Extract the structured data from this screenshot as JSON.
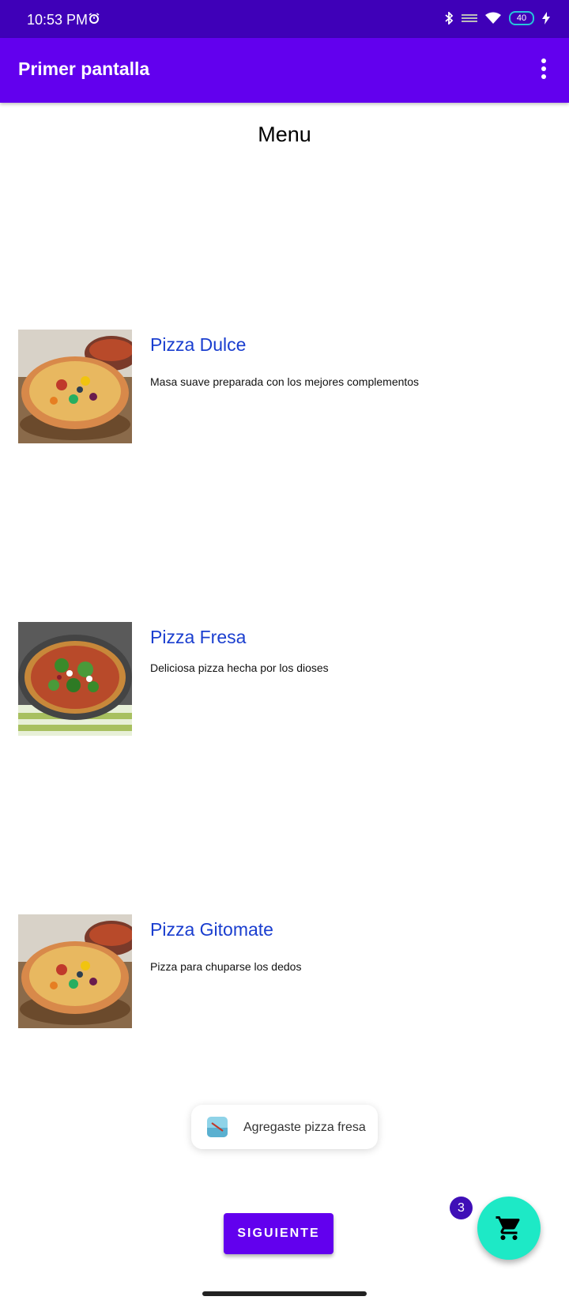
{
  "status_bar": {
    "time": "10:53 PM",
    "battery": "40",
    "icons": [
      "alarm-icon",
      "bluetooth-icon",
      "signal-icon",
      "wifi-icon",
      "battery-icon",
      "charging-icon"
    ]
  },
  "app_bar": {
    "title": "Primer pantalla",
    "menu_icon": "overflow-menu-icon"
  },
  "menu_title": "Menu",
  "products": [
    {
      "name": "Pizza Dulce",
      "description": "Masa suave preparada con los mejores complementos",
      "image": "pizza-veggie-image"
    },
    {
      "name": "Pizza Fresa",
      "description": "Deliciosa pizza hecha por los dioses",
      "image": "pizza-arugula-image"
    },
    {
      "name": "Pizza Gitomate",
      "description": "Pizza para chuparse los dedos",
      "image": "pizza-veggie-image"
    }
  ],
  "toast": {
    "text": "Agregaste pizza fresa"
  },
  "next_button": {
    "label": "SIGUIENTE"
  },
  "cart": {
    "badge_count": "3",
    "icon": "shopping-cart-icon"
  },
  "colors": {
    "status_bar": "#3f00b8",
    "app_bar": "#6200ee",
    "product_title": "#1a3ecf",
    "fab": "#1de9c6",
    "badge": "#3f0fb7"
  }
}
